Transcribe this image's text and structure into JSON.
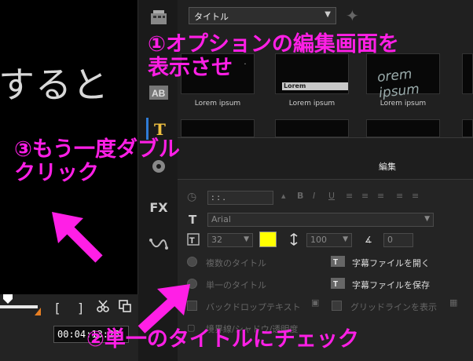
{
  "preview": {
    "text": "すると"
  },
  "transport": {
    "mark_in": "[",
    "mark_out": "]",
    "cut_icon": "scissors-icon",
    "copy_icon": "copy-icon",
    "timecode": "00:04:13:23"
  },
  "library": {
    "dropdown_value": "タイトル",
    "thumbnails": [
      {
        "caption": "Lorem ipsum",
        "art": "· · · · ·"
      },
      {
        "caption": "Lorem ipsum",
        "art": "Lorem"
      },
      {
        "caption": "Lorem ipsum",
        "art": "orem ipsum"
      }
    ]
  },
  "options": {
    "tab_label": "編集",
    "time_value": ":  :  .",
    "format_buttons": [
      "B",
      "I",
      "U",
      "≡",
      "≡",
      "≡",
      "≡",
      "≡"
    ],
    "font": "Arial",
    "font_size": "32",
    "line_spacing": "100",
    "angle": "0",
    "text_color": "#ffff00",
    "radio_multi": "複数のタイトル",
    "radio_single": "単一のタイトル",
    "open_subtitle": "字幕ファイルを開く",
    "save_subtitle": "字幕ファイルを保存",
    "backdrop_text": "バックドロップテキスト",
    "grid_lines": "グリッドラインを表示",
    "border_shadow": "境界線/シャドウ/透明度"
  },
  "annotations": {
    "step1_line1": "①オプションの編集画面を",
    "step1_line2": "表示させ",
    "step2": "②単一のタイトルにチェック",
    "step3_line1": "③もう一度ダブル",
    "step3_line2": "クリック",
    "color": "#ff1fe6"
  }
}
